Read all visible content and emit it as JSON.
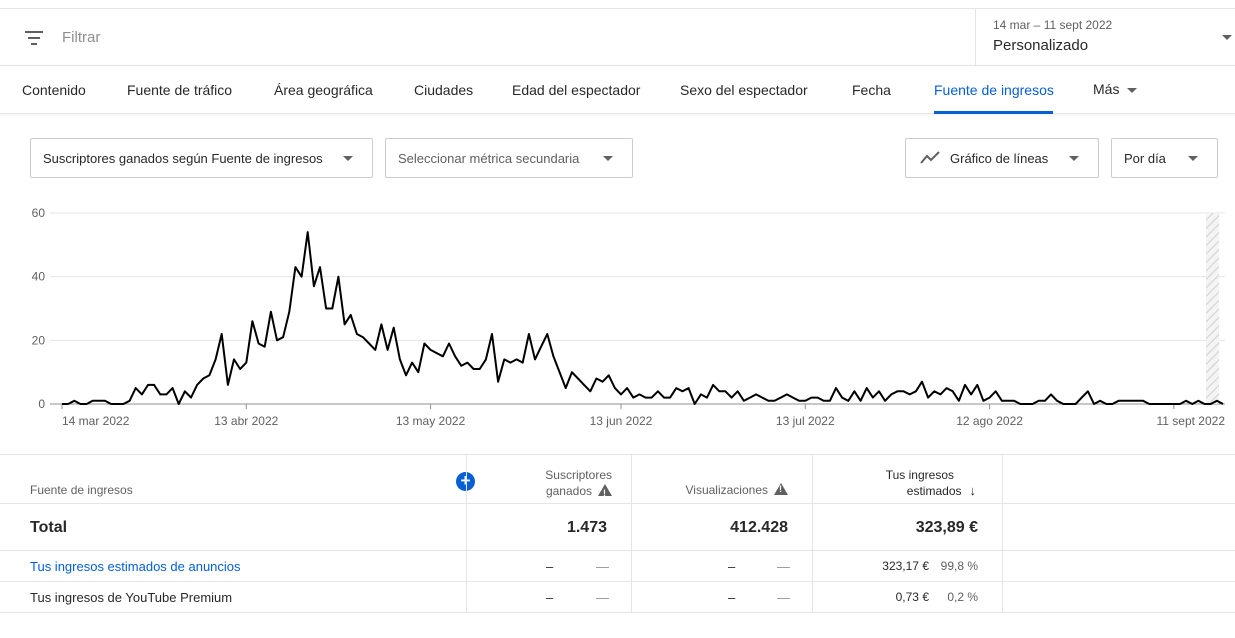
{
  "filter": {
    "placeholder": "Filtrar"
  },
  "date_picker": {
    "range": "14 mar – 11 sept 2022",
    "mode": "Personalizado"
  },
  "tabs": [
    {
      "label": "Contenido"
    },
    {
      "label": "Fuente de tráfico"
    },
    {
      "label": "Área geográfica"
    },
    {
      "label": "Ciudades"
    },
    {
      "label": "Edad del espectador"
    },
    {
      "label": "Sexo del espectador"
    },
    {
      "label": "Fecha"
    },
    {
      "label": "Fuente de ingresos",
      "active": true
    },
    {
      "label": "Más"
    }
  ],
  "selectors": {
    "primary_metric": "Suscriptores ganados según Fuente de ingresos",
    "secondary_metric": "Seleccionar métrica secundaria",
    "chart_type": "Gráfico de líneas",
    "granularity": "Por día"
  },
  "chart_data": {
    "type": "line",
    "y_ticks": [
      "0",
      "20",
      "40",
      "60"
    ],
    "ylim": [
      0,
      60
    ],
    "x_tick_labels": [
      "14 mar 2022",
      "13 abr 2022",
      "13 may 2022",
      "13 jun 2022",
      "13 jul 2022",
      "12 ago 2022",
      "11 sept 2022"
    ],
    "x_tick_day_index": [
      0,
      30,
      60,
      91,
      121,
      151,
      181
    ],
    "series": [
      {
        "values": [
          0,
          0,
          1,
          0,
          0,
          1,
          1,
          1,
          0,
          0,
          0,
          1,
          5,
          3,
          6,
          6,
          3,
          3,
          5,
          0,
          4,
          2,
          6,
          8,
          9,
          14,
          22,
          6,
          14,
          11,
          13,
          26,
          19,
          18,
          29,
          20,
          21,
          29,
          43,
          40,
          54,
          37,
          43,
          30,
          30,
          40,
          25,
          28,
          22,
          21,
          19,
          17,
          25,
          17,
          24,
          14,
          9,
          13,
          10,
          19,
          17,
          16,
          15,
          19,
          15,
          12,
          13,
          11,
          11,
          14,
          22,
          7,
          14,
          13,
          14,
          13,
          22,
          14,
          18,
          22,
          15,
          10,
          5,
          10,
          8,
          6,
          4,
          8,
          7,
          9,
          5,
          3,
          5,
          2,
          3,
          2,
          2,
          4,
          2,
          2,
          5,
          4,
          5,
          0,
          3,
          2,
          6,
          4,
          4,
          2,
          4,
          1,
          2,
          3,
          2,
          1,
          1,
          2,
          3,
          2,
          1,
          1,
          2,
          2,
          1,
          1,
          5,
          2,
          1,
          4,
          1,
          5,
          2,
          4,
          1,
          3,
          4,
          4,
          3,
          4,
          7,
          2,
          4,
          3,
          5,
          4,
          1,
          6,
          3,
          6,
          1,
          2,
          4,
          1,
          1,
          1,
          0,
          0,
          0,
          1,
          1,
          3,
          1,
          0,
          0,
          0,
          2,
          4,
          0,
          1,
          0,
          0,
          1,
          1,
          1,
          1,
          1,
          0,
          0,
          0,
          0,
          0,
          0,
          1,
          0,
          1,
          0,
          0,
          1,
          0
        ]
      }
    ]
  },
  "table": {
    "header": {
      "dimension": "Fuente de ingresos",
      "col1": "Suscriptores ganados",
      "col1_line1": "Suscriptores",
      "col1_line2": "ganados",
      "col2": "Visualizaciones",
      "col3_line1": "Tus ingresos",
      "col3_line2": "estimados"
    },
    "total": {
      "label": "Total",
      "subs": "1.473",
      "views": "412.428",
      "revenue": "323,89 €"
    },
    "rows": [
      {
        "label": "Tus ingresos estimados de anuncios",
        "subs": "–",
        "subs_pct": "—",
        "views": "–",
        "views_pct": "—",
        "revenue": "323,17 €",
        "revenue_pct": "99,8 %"
      },
      {
        "label": "Tus ingresos de YouTube Premium",
        "subs": "–",
        "subs_pct": "—",
        "views": "–",
        "views_pct": "—",
        "revenue": "0,73 €",
        "revenue_pct": "0,2 %"
      }
    ]
  },
  "colors": {
    "accent": "#065fd4",
    "line": "#000000"
  }
}
